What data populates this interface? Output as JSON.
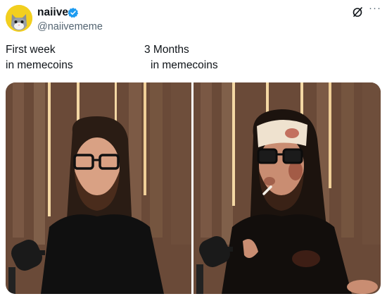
{
  "author": {
    "name": "naiive",
    "handle": "@naiivememe",
    "verified": true,
    "avatar": "cartoon-cat-avatar",
    "badge_color": "#1d9bf0"
  },
  "header_icons": {
    "grok": "grok-slash-icon",
    "more": "···"
  },
  "caption": {
    "left_line1": "First week",
    "left_line2": "in memecoins",
    "right_line1": "3 Months",
    "right_line2": "in memecoins"
  },
  "media": {
    "left_image": "clean-man-glasses-podcast",
    "right_image": "battered-man-bandage-cigarette-podcast"
  }
}
